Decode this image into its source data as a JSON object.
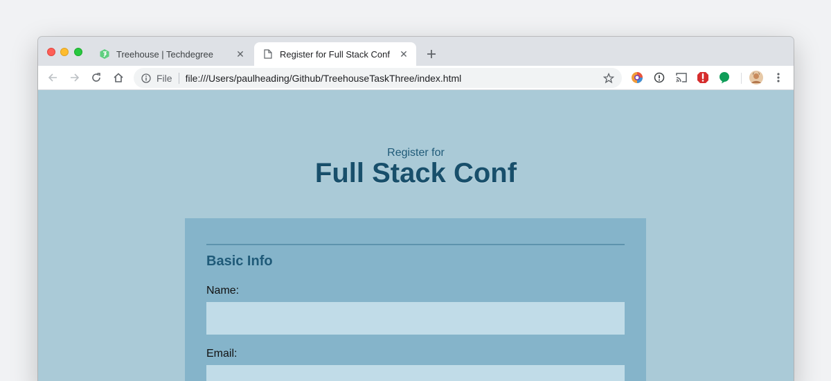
{
  "browser": {
    "tabs": [
      {
        "title": "Treehouse | Techdegree",
        "favicon": "treehouse-icon",
        "active": false
      },
      {
        "title": "Register for Full Stack Conf",
        "favicon": "document-icon",
        "active": true
      }
    ],
    "address_bar": {
      "scheme_label": "File",
      "url": "file:///Users/paulheading/Github/TreehouseTaskThree/index.html"
    },
    "extensions": [
      "color-wheel-icon",
      "info-icon",
      "cast-icon",
      "opera-icon",
      "chat-bubble-icon"
    ]
  },
  "page": {
    "subtitle": "Register for",
    "title": "Full Stack Conf",
    "section": {
      "title": "Basic Info",
      "fields": [
        {
          "label": "Name:",
          "value": ""
        },
        {
          "label": "Email:",
          "value": ""
        }
      ]
    }
  },
  "colors": {
    "page_background": "#aacad7",
    "form_background": "#85b4ca",
    "input_background": "#c1dce8",
    "heading": "#184f6b"
  }
}
